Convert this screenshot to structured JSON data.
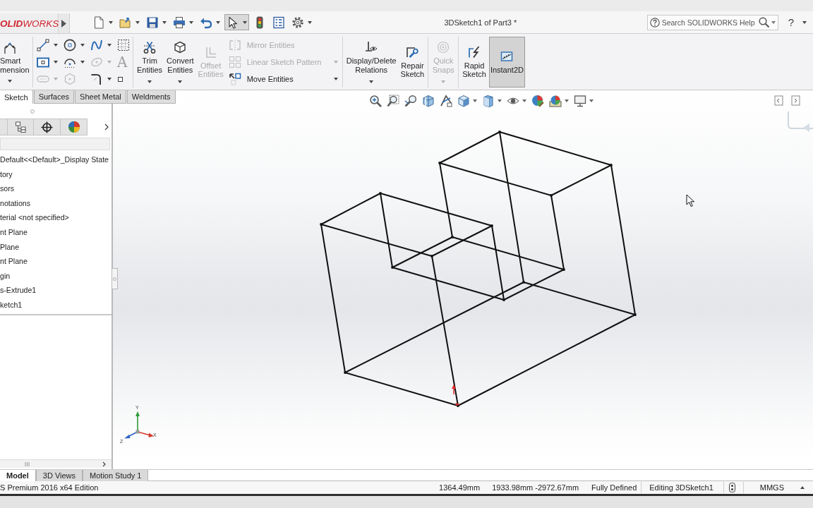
{
  "title_bar": {
    "logo": "**OLID**WORKS",
    "document_title": "3DSketch1 of Part3 *",
    "search": {
      "placeholder": "Search SOLIDWORKS Help"
    },
    "help": "?"
  },
  "quick_access": [
    {
      "kind": "new",
      "dropdown": true,
      "selected": false
    },
    {
      "kind": "open",
      "dropdown": true,
      "selected": false
    },
    {
      "kind": "save",
      "dropdown": true,
      "selected": false
    },
    {
      "kind": "print",
      "dropdown": true,
      "selected": false
    },
    {
      "kind": "undo",
      "dropdown": true,
      "selected": false
    },
    {
      "kind": "select",
      "dropdown": true,
      "selected": true
    },
    {
      "kind": "rebuild",
      "dropdown": false,
      "selected": false
    },
    {
      "kind": "properties",
      "dropdown": false,
      "selected": false
    },
    {
      "kind": "options",
      "dropdown": true,
      "selected": false
    }
  ],
  "ribbon": {
    "smart_dimension": {
      "label_lines": [
        "Smart",
        "mension"
      ],
      "dropdown": true
    },
    "sketch_tools": [
      {
        "kind": "line",
        "disabled": false,
        "dropdown": true
      },
      {
        "kind": "circle",
        "disabled": false,
        "dropdown": true
      },
      {
        "kind": "spline",
        "disabled": false,
        "dropdown": true
      },
      {
        "kind": "grid",
        "disabled": false,
        "dropdown": false
      },
      {
        "kind": "rectangle",
        "disabled": false,
        "dropdown": true
      },
      {
        "kind": "arc",
        "disabled": false,
        "dropdown": true
      },
      {
        "kind": "ellipse",
        "disabled": true,
        "dropdown": true
      },
      {
        "kind": "text",
        "glyph": "A",
        "disabled": true,
        "dropdown": false
      },
      {
        "kind": "slot",
        "disabled": true,
        "dropdown": true
      },
      {
        "kind": "polygon",
        "disabled": true,
        "dropdown": false
      },
      {
        "kind": "fillet",
        "disabled": false,
        "dropdown": true
      },
      {
        "kind": "point",
        "disabled": false,
        "dropdown": false
      }
    ],
    "entity_buttons": [
      {
        "kind": "trim",
        "label_lines": [
          "Trim",
          "Entities"
        ],
        "disabled": false,
        "selected": false,
        "dropdown": true
      },
      {
        "kind": "convert",
        "label_lines": [
          "Convert",
          "Entities"
        ],
        "disabled": false,
        "selected": false,
        "dropdown": true
      },
      {
        "kind": "offset",
        "label_lines": [
          "Offset",
          "Entities"
        ],
        "disabled": true,
        "selected": false,
        "dropdown": false
      }
    ],
    "entity_list": [
      {
        "kind": "mirror",
        "label": "Mirror Entities",
        "disabled": true,
        "dropdown": false
      },
      {
        "kind": "pattern",
        "label": "Linear Sketch Pattern",
        "disabled": true,
        "dropdown": true
      },
      {
        "kind": "move",
        "label": "Move Entities",
        "disabled": false,
        "dropdown": true
      }
    ],
    "tool_groups": [
      [
        {
          "kind": "relations",
          "label_lines": [
            "Display/Delete",
            "Relations"
          ],
          "disabled": false,
          "selected": false,
          "dropdown": true
        },
        {
          "kind": "repair",
          "label_lines": [
            "Repair",
            "Sketch"
          ],
          "disabled": false,
          "selected": false,
          "dropdown": false
        }
      ],
      [
        {
          "kind": "snaps",
          "label_lines": [
            "Quick",
            "Snaps"
          ],
          "disabled": true,
          "selected": false,
          "dropdown": true
        }
      ],
      [
        {
          "kind": "rapid",
          "label_lines": [
            "Rapid",
            "Sketch"
          ],
          "disabled": false,
          "selected": false,
          "dropdown": false
        },
        {
          "kind": "instant2d",
          "label_lines": [
            "Instant2D"
          ],
          "disabled": false,
          "selected": true,
          "dropdown": false
        }
      ]
    ]
  },
  "command_tabs": [
    {
      "label": "Sketch",
      "selected": true
    },
    {
      "label": "Surfaces",
      "selected": false
    },
    {
      "label": "Sheet Metal",
      "selected": false
    },
    {
      "label": "Weldments",
      "selected": false
    }
  ],
  "feature_manager": {
    "tree": [
      "Default<<Default>_Display State",
      "tory",
      "sors",
      "notations",
      "terial <not specified>",
      "nt Plane",
      "Plane",
      "nt Plane",
      "gin",
      "s-Extrude1",
      "ketch1"
    ]
  },
  "viewport": {
    "triad": {
      "y": "Y",
      "x": "X",
      "z": "Z"
    }
  },
  "bottom_tabs": [
    {
      "label": "Model",
      "selected": true
    },
    {
      "label": "3D Views",
      "selected": false
    },
    {
      "label": "Motion Study 1",
      "selected": false
    }
  ],
  "status_bar": {
    "edition": "S Premium 2016 x64 Edition",
    "fields": [
      "1364.49mm",
      "1933.98mm -2972.67mm",
      "Fully Defined",
      "Editing 3DSketch1"
    ],
    "units": "MMGS"
  }
}
